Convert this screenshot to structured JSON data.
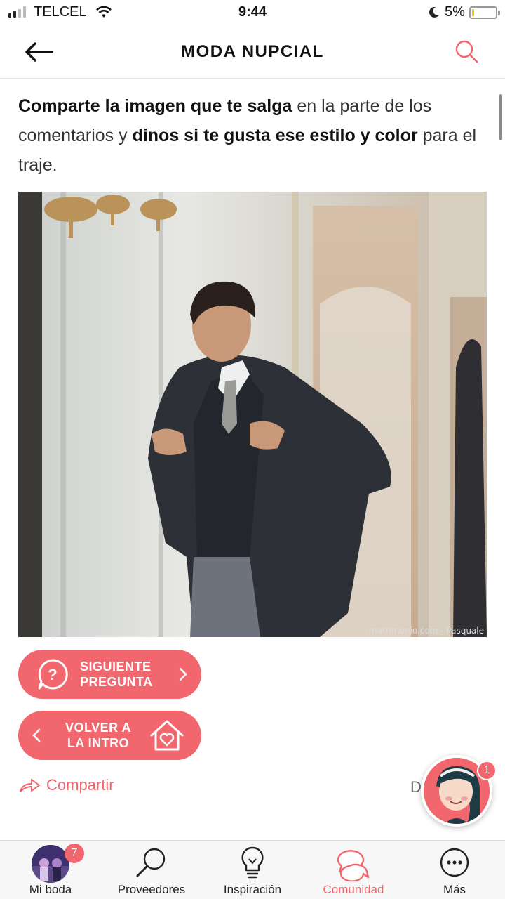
{
  "status_bar": {
    "carrier": "TELCEL",
    "time": "9:44",
    "battery": "5%"
  },
  "header": {
    "title": "MODA NUPCIAL"
  },
  "content": {
    "intro_bold_1": "Comparte la imagen que te salga",
    "intro_text_1": " en la parte de los comentarios y ",
    "intro_bold_2": "dinos si te gusta ese estilo y color",
    "intro_text_2": " para el traje.",
    "photo_credit": "matrimonio.com - Pasquale",
    "next_line_1": "SIGUIENTE",
    "next_line_2": "PREGUNTA",
    "back_line_1": "VOLVER A",
    "back_line_2": "LA INTRO",
    "share_label": "Compartir",
    "peek_letter": "D"
  },
  "assistant": {
    "badge": "1"
  },
  "tabbar": {
    "tabs": [
      {
        "label": "Mi boda",
        "badge": "7"
      },
      {
        "label": "Proveedores"
      },
      {
        "label": "Inspiración"
      },
      {
        "label": "Comunidad"
      },
      {
        "label": "Más"
      }
    ],
    "active": "Comunidad"
  },
  "colors": {
    "accent": "#f2666d",
    "text": "#222222",
    "divider": "#e2e2e2"
  }
}
